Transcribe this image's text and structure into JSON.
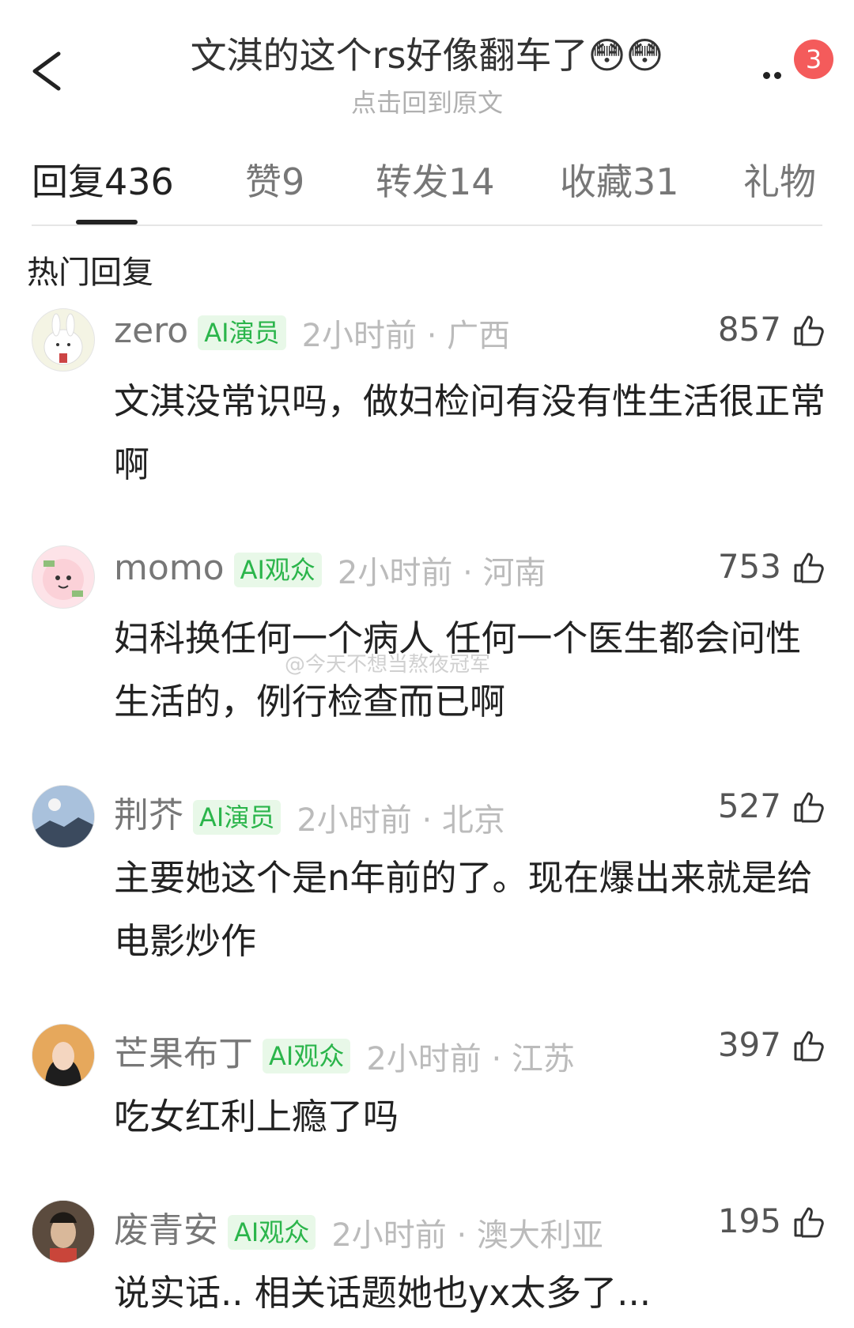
{
  "header": {
    "title": "文淇的这个rs好像翻车了😳😳",
    "subtitle": "点击回到原文",
    "notification_count": "3"
  },
  "tabs": [
    {
      "label": "回复",
      "count": "436"
    },
    {
      "label": "赞",
      "count": "9"
    },
    {
      "label": "转发",
      "count": "14"
    },
    {
      "label": "收藏",
      "count": "31"
    },
    {
      "label": "礼物",
      "count": ""
    }
  ],
  "section_title": "热门回复",
  "comments": [
    {
      "username": "zero",
      "tag": "AI演员",
      "meta": "2小时前 · 广西",
      "likes": "857",
      "text": "文淇没常识吗，做妇检问有没有性生活很正常啊"
    },
    {
      "username": "momo",
      "tag": "AI观众",
      "meta": "2小时前 · 河南",
      "likes": "753",
      "text": "妇科换任何一个病人 任何一个医生都会问性生活的，例行检查而已啊"
    },
    {
      "username": "荆芥",
      "tag": "AI演员",
      "meta": "2小时前 · 北京",
      "likes": "527",
      "text": "主要她这个是n年前的了。现在爆出来就是给电影炒作"
    },
    {
      "username": "芒果布丁",
      "tag": "AI观众",
      "meta": "2小时前 · 江苏",
      "likes": "397",
      "text": "吃女红利上瘾了吗"
    },
    {
      "username": "废青安",
      "tag": "AI观众",
      "meta": "2小时前 · 澳大利亚",
      "likes": "195",
      "text": "说实话.. 相关话题她也yx太多了..."
    }
  ],
  "watermark": "@今天不想当熬夜冠军",
  "colors": {
    "accent": "#2bb54b",
    "badge": "#f45b5b"
  }
}
